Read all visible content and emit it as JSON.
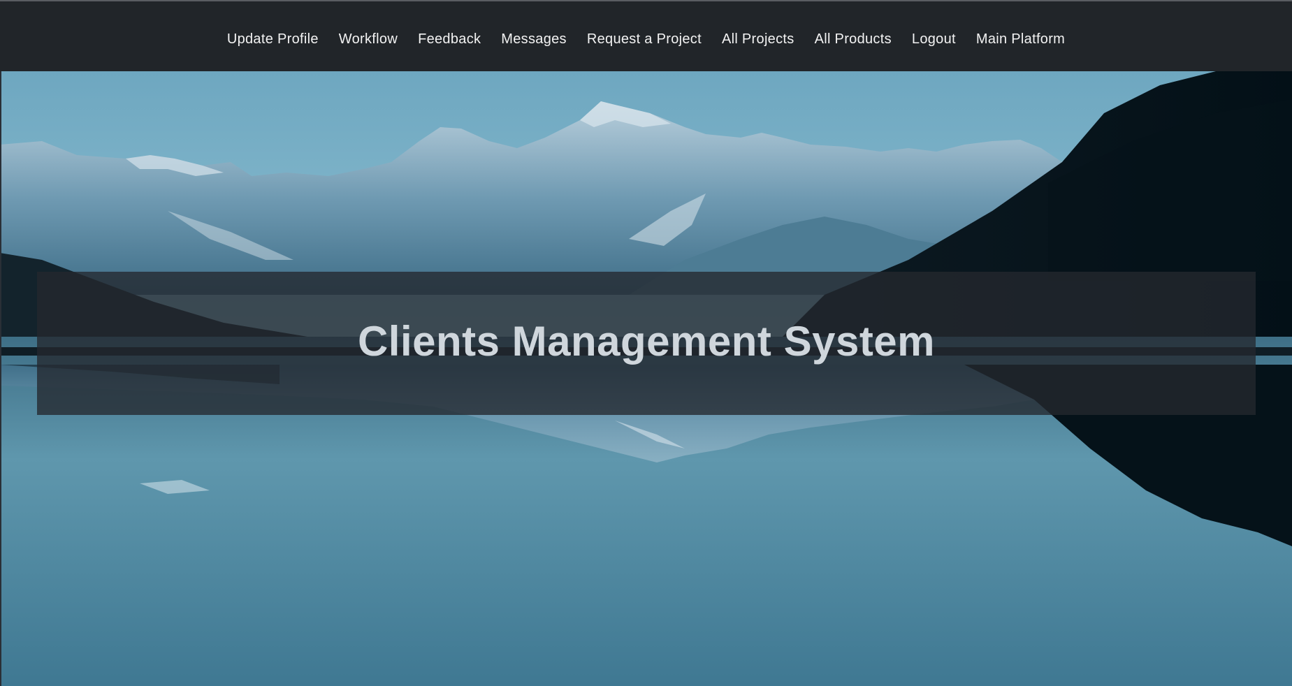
{
  "nav": {
    "items": [
      {
        "label": "Update Profile"
      },
      {
        "label": "Workflow"
      },
      {
        "label": "Feedback"
      },
      {
        "label": "Messages"
      },
      {
        "label": "Request a Project"
      },
      {
        "label": "All Projects"
      },
      {
        "label": "All Products"
      },
      {
        "label": "Logout"
      },
      {
        "label": "Main Platform"
      }
    ]
  },
  "hero": {
    "title": "Clients Management System"
  },
  "colors": {
    "navbar_bg": "#212529",
    "nav_text": "#f3f3f3",
    "title_text": "#cfd6dc",
    "panel_bg": "#24282e",
    "sky": "#7fb4c8",
    "water": "#4f8aa3"
  }
}
